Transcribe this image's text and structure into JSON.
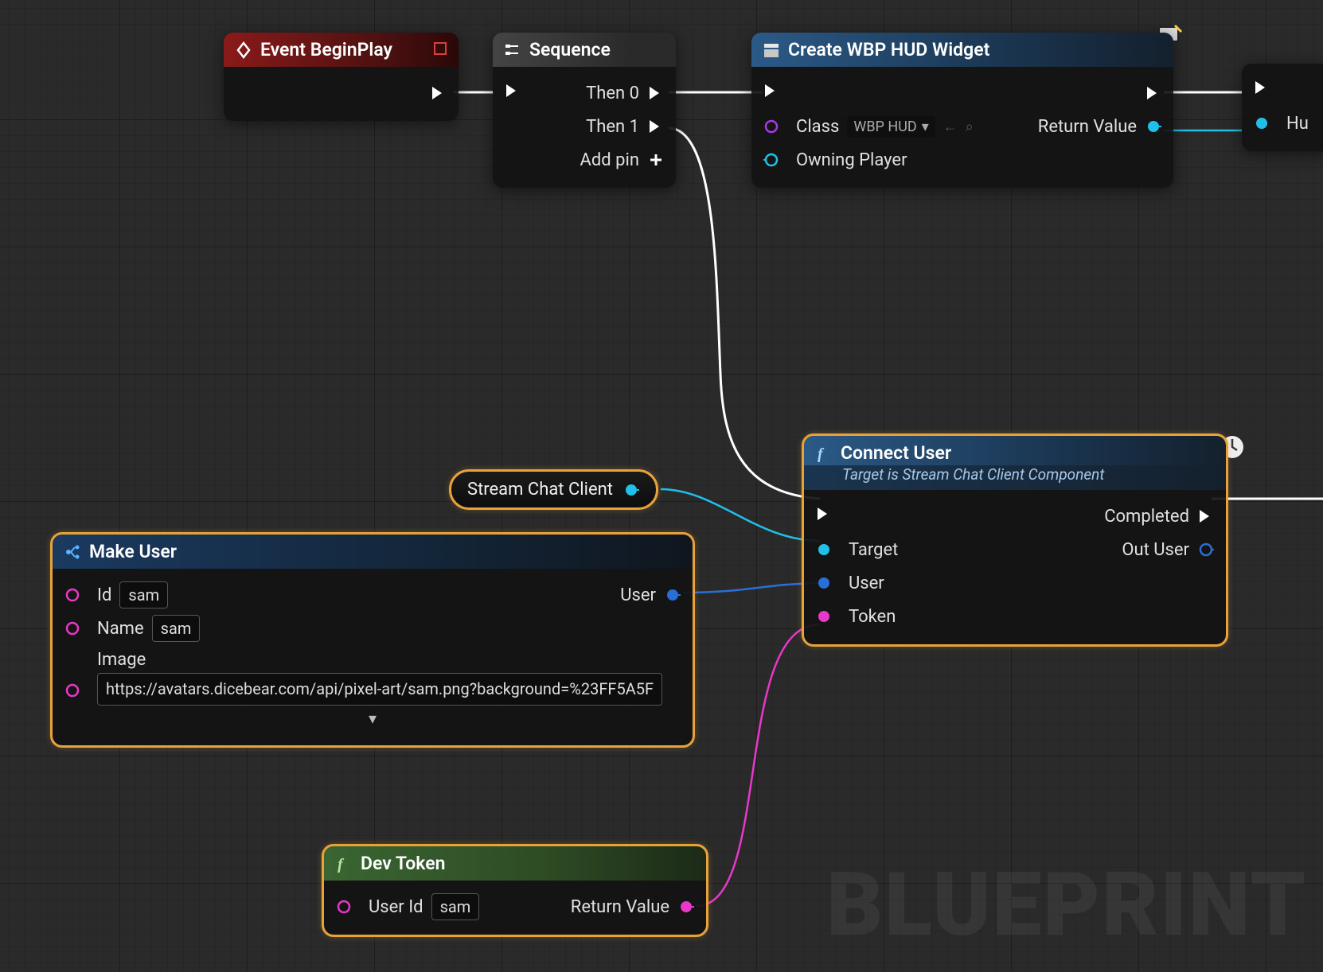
{
  "watermark": "BLUEPRINT",
  "nodes": {
    "event_begin_play": {
      "title": "Event BeginPlay"
    },
    "sequence": {
      "title": "Sequence",
      "then0": "Then 0",
      "then1": "Then 1",
      "add_pin": "Add pin"
    },
    "create_widget": {
      "title": "Create WBP HUD Widget",
      "class_label": "Class",
      "class_value": "WBP HUD",
      "owning_player": "Owning Player",
      "return_value": "Return Value"
    },
    "stream_chat_client": {
      "label": "Stream Chat Client"
    },
    "make_user": {
      "title": "Make User",
      "id_label": "Id",
      "id_value": "sam",
      "name_label": "Name",
      "name_value": "sam",
      "image_label": "Image",
      "image_value": "https://avatars.dicebear.com/api/pixel-art/sam.png?background=%23FF5A5F",
      "user_out": "User"
    },
    "dev_token": {
      "title": "Dev Token",
      "user_id_label": "User Id",
      "user_id_value": "sam",
      "return_value": "Return Value"
    },
    "connect_user": {
      "title": "Connect User",
      "subtitle": "Target is Stream Chat Client Component",
      "target": "Target",
      "user": "User",
      "token": "Token",
      "completed": "Completed",
      "out_user": "Out User"
    },
    "right_edge": {
      "hu": "Hu"
    }
  }
}
